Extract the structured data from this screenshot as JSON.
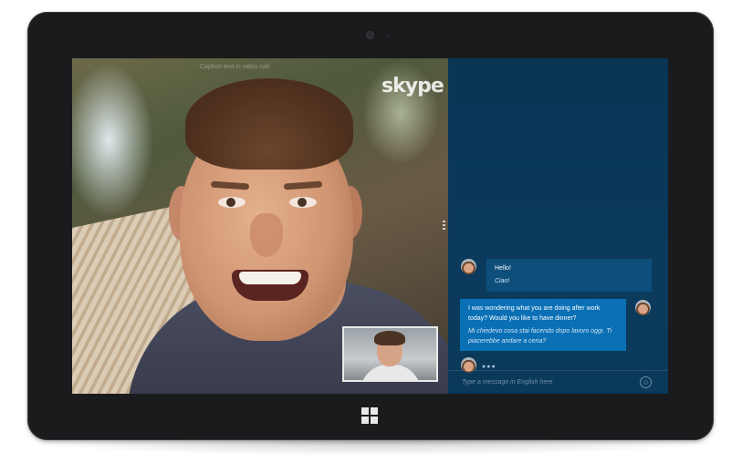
{
  "app": {
    "logo_text": "skype",
    "video_caption_hint": "Caption text in video call"
  },
  "chat": {
    "messages": [
      {
        "original": "Hello!",
        "translation": "Ciao!"
      },
      {
        "original": "I was wondering what you are doing after work today? Would you like to have dinner?",
        "translation": "Mi chiedevo cosa stai facendo dopo lavoro oggi. Ti piacerebbe andare a cena?"
      }
    ],
    "typing_indicator": "●●●",
    "input_placeholder": "Type a message in English here",
    "emoji_glyph": "☺"
  },
  "colors": {
    "chat_background": "#0b3a5c",
    "incoming_bubble": "#0d4e7a",
    "outgoing_bubble": "#0a70b6"
  },
  "icons": {
    "windows_button": "windows-logo-icon",
    "emoji_button": "emoji-icon"
  }
}
